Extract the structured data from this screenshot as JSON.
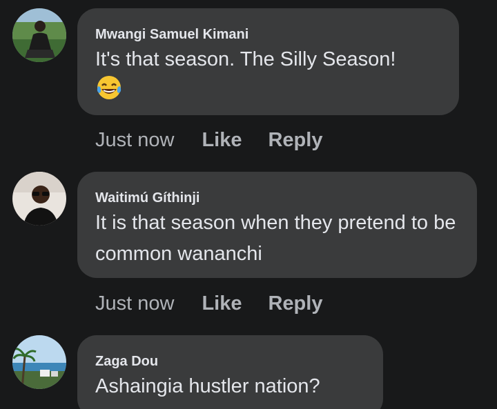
{
  "comments": [
    {
      "author": "Mwangi Samuel Kimani",
      "text": "It's that season. The Silly Season!",
      "emoji": "tears-of-joy",
      "time": "Just now",
      "like_label": "Like",
      "reply_label": "Reply"
    },
    {
      "author": "Waitimú Gíthinji",
      "text": "It is that season when they pretend to be common wananchi",
      "time": "Just now",
      "like_label": "Like",
      "reply_label": "Reply"
    },
    {
      "author": "Zaga Dou",
      "text": "Ashaingia hustler nation?"
    }
  ],
  "colors": {
    "background": "#18191a",
    "bubble": "#3a3b3c",
    "primary_text": "#e4e6eb",
    "secondary_text": "#b0b3b8"
  }
}
